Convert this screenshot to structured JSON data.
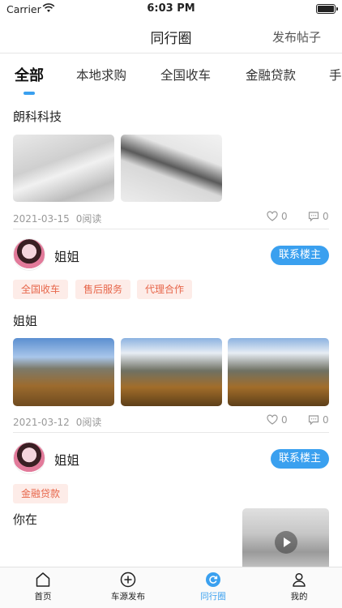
{
  "status_bar": {
    "carrier": "Carrier",
    "time": "6:03 PM"
  },
  "navbar": {
    "title": "同行圈",
    "publish": "发布帖子"
  },
  "tabs": [
    {
      "label": "全部",
      "active": true
    },
    {
      "label": "本地求购",
      "active": false
    },
    {
      "label": "全国收车",
      "active": false
    },
    {
      "label": "金融贷款",
      "active": false
    },
    {
      "label": "手",
      "active": false
    }
  ],
  "posts": [
    {
      "text": "朗科科技",
      "images": [
        "snow-figures-photo",
        "snow-people-photo"
      ],
      "date": "2021-03-15",
      "reads": "0阅读",
      "likes": "0",
      "comments": "0"
    },
    {
      "author": "姐姐",
      "contact": "联系楼主",
      "tags": [
        "全国收车",
        "售后服务",
        "代理合作"
      ],
      "text": "姐姐",
      "images": [
        "autumn-mountain-photo-1",
        "autumn-mountain-photo-2",
        "autumn-mountain-photo-3"
      ],
      "date": "2021-03-12",
      "reads": "0阅读",
      "likes": "0",
      "comments": "0"
    },
    {
      "author": "姐姐",
      "contact": "联系楼主",
      "tags": [
        "金融贷款"
      ],
      "text": "你在",
      "images": [
        "snow-video-thumbnail"
      ]
    }
  ],
  "tabbar": [
    {
      "label": "首页",
      "icon": "home-icon",
      "active": false
    },
    {
      "label": "车源发布",
      "icon": "add-circle-icon",
      "active": false
    },
    {
      "label": "同行圈",
      "icon": "refresh-circle-icon",
      "active": true
    },
    {
      "label": "我的",
      "icon": "user-icon",
      "active": false
    }
  ],
  "colors": {
    "accent": "#3aa0ef",
    "tag_bg": "#fdece8",
    "tag_text": "#e7664a"
  }
}
